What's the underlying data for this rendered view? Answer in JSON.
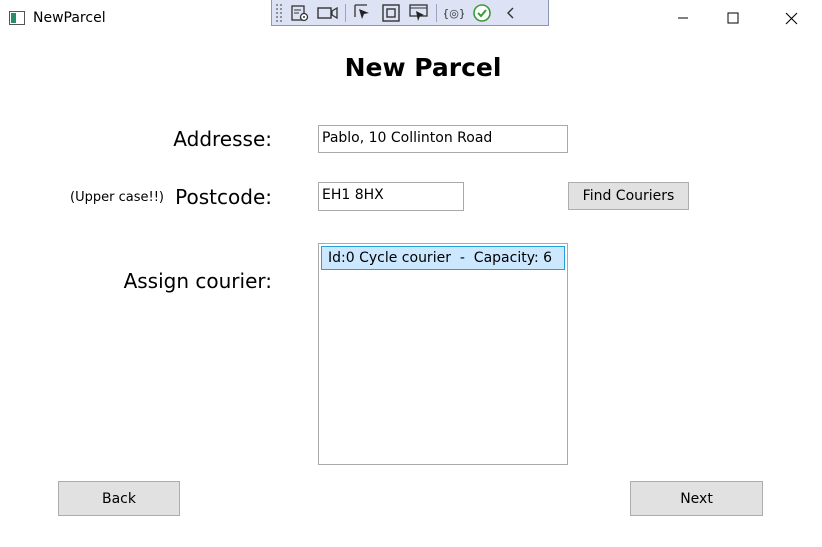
{
  "window": {
    "title": "NewParcel",
    "controls": {
      "minimize": "minimize-icon",
      "maximize": "maximize-icon",
      "close": "close-icon"
    }
  },
  "devbar": {
    "icons": [
      "live-visual-tree-icon",
      "track-focus-icon",
      "select-element-icon",
      "display-layout-adorners-icon",
      "preview-selection-icon",
      "binding-failures-icon",
      "hot-reload-status-icon",
      "collapse-toolbar-icon"
    ]
  },
  "form": {
    "heading": "New Parcel",
    "address": {
      "label": "Addresse:",
      "value": "Pablo, 10 Collinton Road"
    },
    "postcode": {
      "label": "Postcode:",
      "hint": "(Upper case!!)",
      "value": "EH1 8HX"
    },
    "find_button": "Find Couriers",
    "courier": {
      "label": "Assign courier:",
      "items": [
        {
          "text": "Id:0 Cycle courier  -  Capacity: 6",
          "selected": true
        }
      ]
    },
    "back_button": "Back",
    "next_button": "Next"
  },
  "colors": {
    "selection_bg": "#cce8ff",
    "selection_border": "#26a0da",
    "button_bg": "#e1e1e1",
    "devbar_bg": "#dde3f4"
  }
}
